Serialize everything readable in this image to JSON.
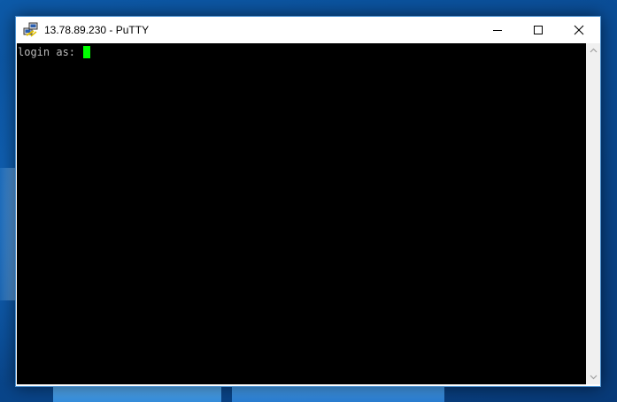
{
  "window": {
    "title": "13.78.89.230 - PuTTY",
    "icon": "putty-icon"
  },
  "titlebar_buttons": {
    "minimize_icon": "minimize-icon",
    "maximize_icon": "maximize-icon",
    "close_icon": "close-icon"
  },
  "terminal": {
    "prompt": "login as: ",
    "cursor_color": "#00ff00",
    "text_color": "#bbbbbb",
    "background": "#000000"
  },
  "scrollbar": {
    "up_icon": "scroll-up-arrow-icon",
    "down_icon": "scroll-down-arrow-icon"
  }
}
